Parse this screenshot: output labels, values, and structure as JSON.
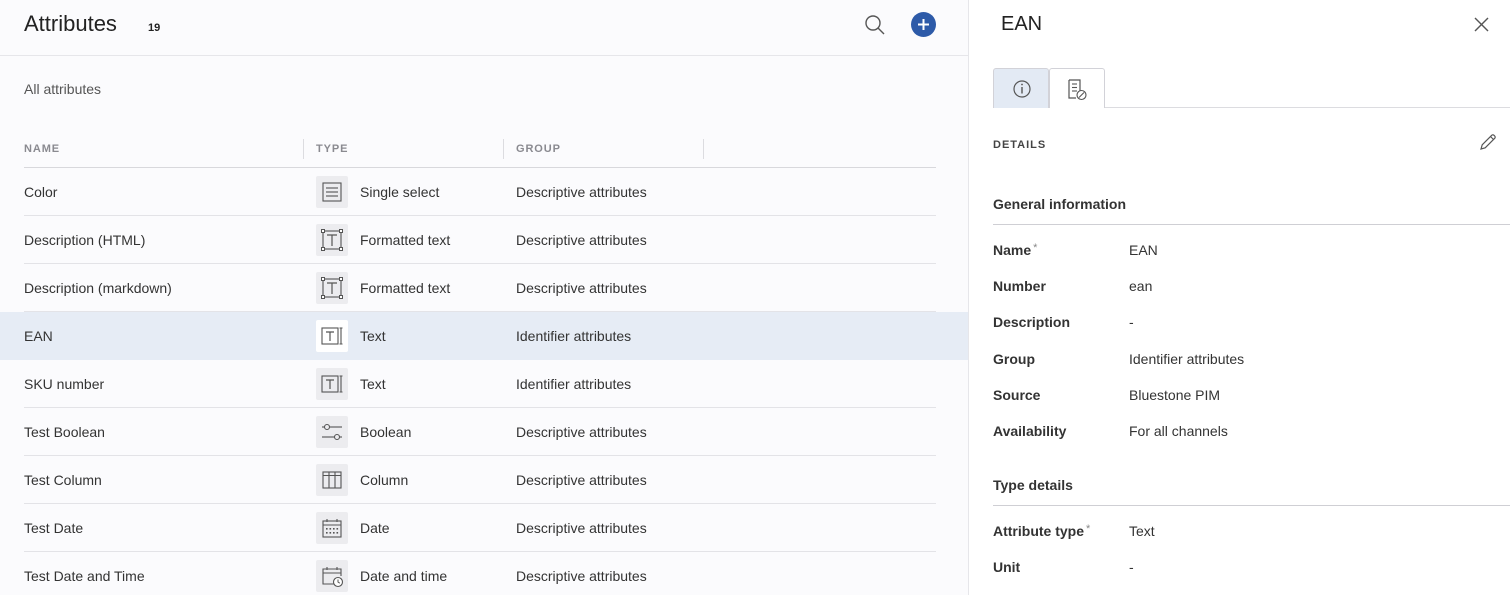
{
  "header": {
    "title": "Attributes",
    "count": "19",
    "subtitle": "All attributes"
  },
  "table": {
    "columns": [
      "NAME",
      "TYPE",
      "GROUP"
    ],
    "rows": [
      {
        "name": "Color",
        "type": "Single select",
        "icon": "single-select-icon",
        "group": "Descriptive attributes",
        "selected": false
      },
      {
        "name": "Description (HTML)",
        "type": "Formatted text",
        "icon": "formatted-text-icon",
        "group": "Descriptive attributes",
        "selected": false
      },
      {
        "name": "Description (markdown)",
        "type": "Formatted text",
        "icon": "formatted-text-icon",
        "group": "Descriptive attributes",
        "selected": false
      },
      {
        "name": "EAN",
        "type": "Text",
        "icon": "text-icon",
        "group": "Identifier attributes",
        "selected": true
      },
      {
        "name": "SKU number",
        "type": "Text",
        "icon": "text-icon",
        "group": "Identifier attributes",
        "selected": false
      },
      {
        "name": "Test Boolean",
        "type": "Boolean",
        "icon": "boolean-icon",
        "group": "Descriptive attributes",
        "selected": false
      },
      {
        "name": "Test Column",
        "type": "Column",
        "icon": "column-icon",
        "group": "Descriptive attributes",
        "selected": false
      },
      {
        "name": "Test Date",
        "type": "Date",
        "icon": "date-icon",
        "group": "Descriptive attributes",
        "selected": false
      },
      {
        "name": "Test Date and Time",
        "type": "Date and time",
        "icon": "date-time-icon",
        "group": "Descriptive attributes",
        "selected": false
      }
    ]
  },
  "detail": {
    "title": "EAN",
    "section_label": "DETAILS",
    "general_heading": "General information",
    "general": [
      {
        "label": "Name",
        "required": "*",
        "value": "EAN"
      },
      {
        "label": "Number",
        "required": "",
        "value": "ean"
      },
      {
        "label": "Description",
        "required": "",
        "value": "-"
      },
      {
        "label": "Group",
        "required": "",
        "value": "Identifier attributes"
      },
      {
        "label": "Source",
        "required": "",
        "value": "Bluestone PIM"
      },
      {
        "label": "Availability",
        "required": "",
        "value": "For all channels"
      }
    ],
    "type_heading": "Type details",
    "type_details": [
      {
        "label": "Attribute type",
        "required": "*",
        "value": "Text"
      },
      {
        "label": "Unit",
        "required": "",
        "value": "-"
      }
    ]
  },
  "colors": {
    "accent": "#2d5aa8",
    "selected_row": "#e6ecf5",
    "active_tab": "#e3eaf4"
  }
}
